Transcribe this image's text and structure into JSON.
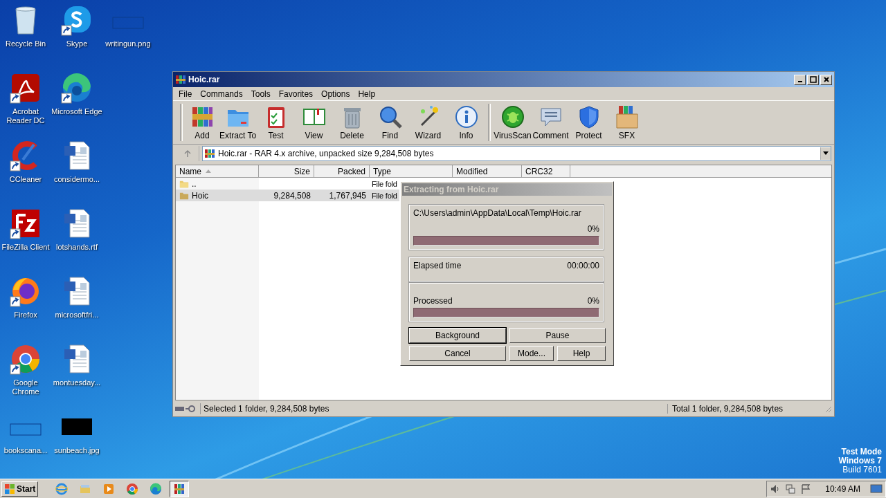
{
  "desktop": {
    "columns": [
      [
        {
          "label": "Recycle Bin",
          "kind": "recycle",
          "shortcut": false
        },
        {
          "label": "Acrobat Reader DC",
          "kind": "acrobat",
          "shortcut": true
        },
        {
          "label": "CCleaner",
          "kind": "ccleaner",
          "shortcut": true
        },
        {
          "label": "FileZilla Client",
          "kind": "filezilla",
          "shortcut": true
        },
        {
          "label": "Firefox",
          "kind": "firefox",
          "shortcut": true
        },
        {
          "label": "Google Chrome",
          "kind": "chrome",
          "shortcut": true
        },
        {
          "label": "bookscana...",
          "kind": "blank",
          "shortcut": false
        }
      ],
      [
        {
          "label": "Skype",
          "kind": "skype",
          "shortcut": true
        },
        {
          "label": "Microsoft Edge",
          "kind": "edge",
          "shortcut": true
        },
        {
          "label": "considermo...",
          "kind": "word",
          "shortcut": false
        },
        {
          "label": "lotshands.rtf",
          "kind": "word",
          "shortcut": false
        },
        {
          "label": "microsoftfri...",
          "kind": "word",
          "shortcut": false
        },
        {
          "label": "montuesday...",
          "kind": "word",
          "shortcut": false
        },
        {
          "label": "sunbeach.jpg",
          "kind": "black",
          "shortcut": false
        }
      ],
      [
        {
          "label": "writingun.png",
          "kind": "blank",
          "shortcut": false
        }
      ]
    ]
  },
  "window": {
    "title": "Hoic.rar",
    "menu": [
      "File",
      "Commands",
      "Tools",
      "Favorites",
      "Options",
      "Help"
    ],
    "toolbar": [
      [
        {
          "label": "Add",
          "kind": "add"
        },
        {
          "label": "Extract To",
          "kind": "extract"
        },
        {
          "label": "Test",
          "kind": "test"
        },
        {
          "label": "View",
          "kind": "view"
        },
        {
          "label": "Delete",
          "kind": "delete"
        },
        {
          "label": "Find",
          "kind": "find"
        },
        {
          "label": "Wizard",
          "kind": "wizard"
        },
        {
          "label": "Info",
          "kind": "info"
        }
      ],
      [
        {
          "label": "VirusScan",
          "kind": "virusscan"
        },
        {
          "label": "Comment",
          "kind": "comment"
        },
        {
          "label": "Protect",
          "kind": "protect"
        },
        {
          "label": "SFX",
          "kind": "sfx"
        }
      ]
    ],
    "address": "Hoic.rar - RAR 4.x archive, unpacked size 9,284,508 bytes",
    "columns": [
      {
        "label": "Name",
        "sorted": true
      },
      {
        "label": "Size",
        "sorted": false
      },
      {
        "label": "Packed",
        "sorted": false
      },
      {
        "label": "Type",
        "sorted": false
      },
      {
        "label": "Modified",
        "sorted": false
      },
      {
        "label": "CRC32",
        "sorted": false
      }
    ],
    "rows": [
      {
        "kind": "up",
        "name": "..",
        "type": "File fold",
        "selected": false
      },
      {
        "kind": "folder",
        "name": "Hoic",
        "size": "9,284,508",
        "packed": "1,767,945",
        "type": "File fold",
        "selected": true
      }
    ],
    "status": {
      "left": "Selected 1 folder, 9,284,508 bytes",
      "right": "Total 1 folder, 9,284,508 bytes"
    }
  },
  "dialog": {
    "title": "Extracting from Hoic.rar",
    "active": false,
    "file": "C:\\Users\\admin\\AppData\\Local\\Temp\\Hoic.rar",
    "file_percent": "0%",
    "file_progress": {
      "level": 0
    },
    "elapsed_label": "Elapsed time",
    "elapsed": "00:00:00",
    "processed_label": "Processed",
    "processed_percent": "0%",
    "processed_progress": {
      "level": 0
    },
    "buttons": [
      {
        "label": "Background",
        "focused": true
      },
      {
        "label": "Pause",
        "focused": false
      },
      {
        "label": "Cancel",
        "focused": false
      },
      {
        "label": "Mode...",
        "focused": false
      },
      {
        "label": "Help",
        "focused": false
      }
    ]
  },
  "taskbar": {
    "start": "Start",
    "apps": [
      {
        "kind": "ie",
        "active": false
      },
      {
        "kind": "explorer",
        "active": false
      },
      {
        "kind": "media",
        "active": false
      },
      {
        "kind": "chrome",
        "active": false
      },
      {
        "kind": "edge",
        "active": false
      },
      {
        "kind": "winrar",
        "active": true
      }
    ],
    "clock": "10:49 AM"
  },
  "os_notice": [
    "Test Mode",
    "Windows 7",
    "Build 7601"
  ]
}
